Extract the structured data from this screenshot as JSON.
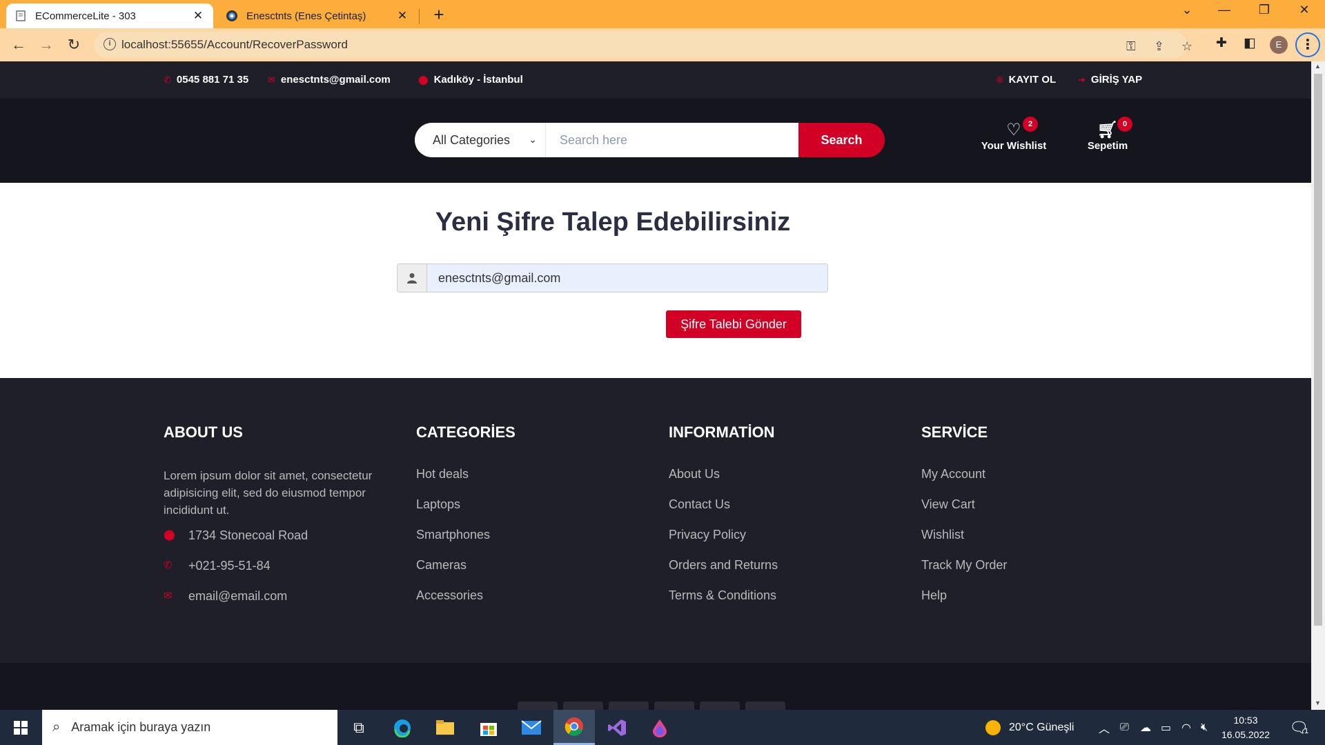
{
  "browser": {
    "tabs": [
      {
        "title": "ECommerceLite - 303",
        "favicon": "page-icon",
        "active": true
      },
      {
        "title": "Enesctnts (Enes Çetintaş)",
        "favicon": "github-icon",
        "active": false
      }
    ],
    "url": "localhost:55655/Account/RecoverPassword",
    "profile_initial": "E",
    "accent_color": "#fdad3b"
  },
  "topbar": {
    "phone": "0545 881 71 35",
    "email": "enesctnts@gmail.com",
    "location": "Kadıköy - İstanbul",
    "register": "KAYIT OL",
    "login": "GİRİŞ YAP"
  },
  "header": {
    "category_select": "All Categories",
    "search_placeholder": "Search here",
    "search_button": "Search",
    "wishlist_label": "Your Wishlist",
    "wishlist_count": "2",
    "cart_label": "Sepetim",
    "cart_count": "0",
    "brand_color": "#d10024"
  },
  "main": {
    "title": "Yeni Şifre Talep Edebilirsiniz",
    "email_value": "enesctnts@gmail.com",
    "submit_button": "Şifre Talebi Gönder"
  },
  "footer": {
    "about": {
      "heading": "ABOUT US",
      "text": "Lorem ipsum dolor sit amet, consectetur adipisicing elit, sed do eiusmod tempor incididunt ut.",
      "address": "1734 Stonecoal Road",
      "phone": "+021-95-51-84",
      "email": "email@email.com"
    },
    "categories": {
      "heading": "CATEGORİES",
      "links": [
        "Hot deals",
        "Laptops",
        "Smartphones",
        "Cameras",
        "Accessories"
      ]
    },
    "information": {
      "heading": "INFORMATİON",
      "links": [
        "About Us",
        "Contact Us",
        "Privacy Policy",
        "Orders and Returns",
        "Terms & Conditions"
      ]
    },
    "service": {
      "heading": "SERVİCE",
      "links": [
        "My Account",
        "View Cart",
        "Wishlist",
        "Track My Order",
        "Help"
      ]
    }
  },
  "taskbar": {
    "search_placeholder": "Aramak için buraya yazın",
    "weather": "20°C  Güneşli",
    "time": "10:53",
    "date": "16.05.2022",
    "notification_count": "1"
  }
}
